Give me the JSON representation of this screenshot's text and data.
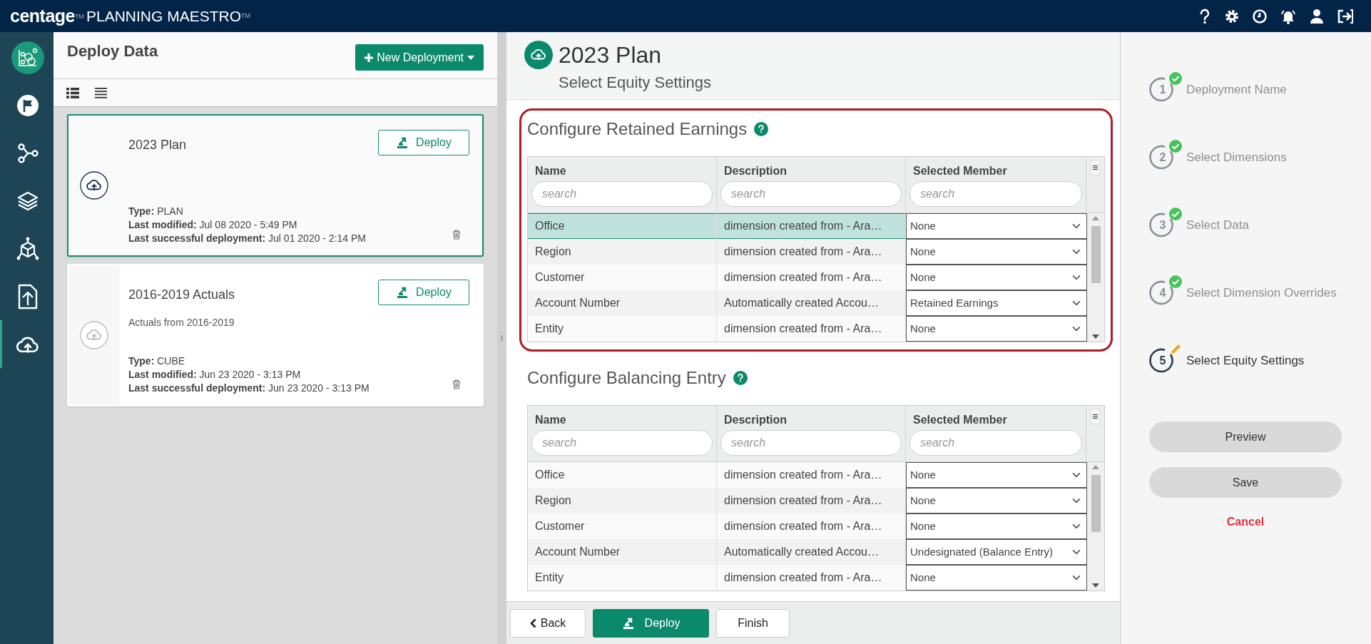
{
  "app_bar": {
    "brand": "centage$^{TM}$",
    "product": "PLANNING MAESTRO$^{TM}$"
  },
  "nav_rail": [
    {
      "kind": "logo",
      "selected": false
    },
    {
      "kind": "flag",
      "selected": false
    },
    {
      "kind": "nodes",
      "selected": false
    },
    {
      "kind": "layers",
      "selected": false
    },
    {
      "kind": "cube",
      "selected": false
    },
    {
      "kind": "file-upload",
      "selected": false
    },
    {
      "kind": "cloud-upload",
      "selected": true
    }
  ],
  "deploy_panel": {
    "title": "Deploy Data",
    "new_button": "New Deployment",
    "deployments": [
      {
        "title": "2023 Plan",
        "type": "**Type:** PLAN",
        "modified": "**Last modified:** Jul 08 2020 - 5:49 PM",
        "deployed": "**Last successful deployment:** Jul 01 2020 - 2:14 PM",
        "deploy_button": "Deploy",
        "selected": true
      },
      {
        "title": "2016-2019 Actuals",
        "description": "Actuals from 2016-2019",
        "type": "**Type:** CUBE",
        "modified": "**Last modified:** Jun 23 2020 - 3:13 PM",
        "deployed": "**Last successful deployment:** Jun 23 2020 - 3:13 PM",
        "deploy_button": "Deploy",
        "selected": false
      }
    ]
  },
  "plan": {
    "title": "2023 Plan",
    "subtitle": "Select Equity Settings"
  },
  "sections": [
    {
      "title": "Configure Retained Earnings",
      "highlighted": true,
      "columns": [
        {
          "label": "Name",
          "placeholder": "search"
        },
        {
          "label": "Description",
          "placeholder": "search"
        },
        {
          "label": "Selected Member",
          "placeholder": "search"
        }
      ],
      "rows": [
        {
          "name": "Office",
          "description": "dimension created from - Ara…",
          "member": "None",
          "selected": true
        },
        {
          "name": "Region",
          "description": "dimension created from - Ara…",
          "member": "None",
          "selected": false
        },
        {
          "name": "Customer",
          "description": "dimension created from - Ara…",
          "member": "None",
          "selected": false
        },
        {
          "name": "Account Number",
          "description": "Automatically created Accou…",
          "member": "Retained Earnings",
          "selected": false
        },
        {
          "name": "Entity",
          "description": "dimension created from - Ara…",
          "member": "None",
          "selected": false
        }
      ]
    },
    {
      "title": "Configure Balancing Entry",
      "highlighted": false,
      "columns": [
        {
          "label": "Name",
          "placeholder": "search"
        },
        {
          "label": "Description",
          "placeholder": "search"
        },
        {
          "label": "Selected Member",
          "placeholder": "search"
        }
      ],
      "rows": [
        {
          "name": "Office",
          "description": "dimension created from - Ara…",
          "member": "None",
          "selected": false
        },
        {
          "name": "Region",
          "description": "dimension created from - Ara…",
          "member": "None",
          "selected": false
        },
        {
          "name": "Customer",
          "description": "dimension created from - Ara…",
          "member": "None",
          "selected": false
        },
        {
          "name": "Account Number",
          "description": "Automatically created Accou…",
          "member": "Undesignated (Balance Entry)",
          "selected": false
        },
        {
          "name": "Entity",
          "description": "dimension created from - Ara…",
          "member": "None",
          "selected": false
        }
      ]
    }
  ],
  "footer_buttons": [
    {
      "label": "Back",
      "kind": "back"
    },
    {
      "label": "Deploy",
      "kind": "deploy"
    },
    {
      "label": "Finish",
      "kind": "plain"
    }
  ],
  "steps": [
    {
      "number": "1",
      "label": "Deployment Name",
      "completed": true,
      "selected": false
    },
    {
      "number": "2",
      "label": "Select Dimensions",
      "completed": true,
      "selected": false
    },
    {
      "number": "3",
      "label": "Select Data",
      "completed": true,
      "selected": false
    },
    {
      "number": "4",
      "label": "Select Dimension Overrides",
      "completed": true,
      "selected": false
    },
    {
      "number": "5",
      "label": "Select Equity Settings",
      "completed": false,
      "selected": true
    }
  ],
  "actions": [
    {
      "label": "Preview",
      "kind": "pill"
    },
    {
      "label": "Save",
      "kind": "pill"
    },
    {
      "label": "Cancel",
      "kind": "link"
    }
  ]
}
